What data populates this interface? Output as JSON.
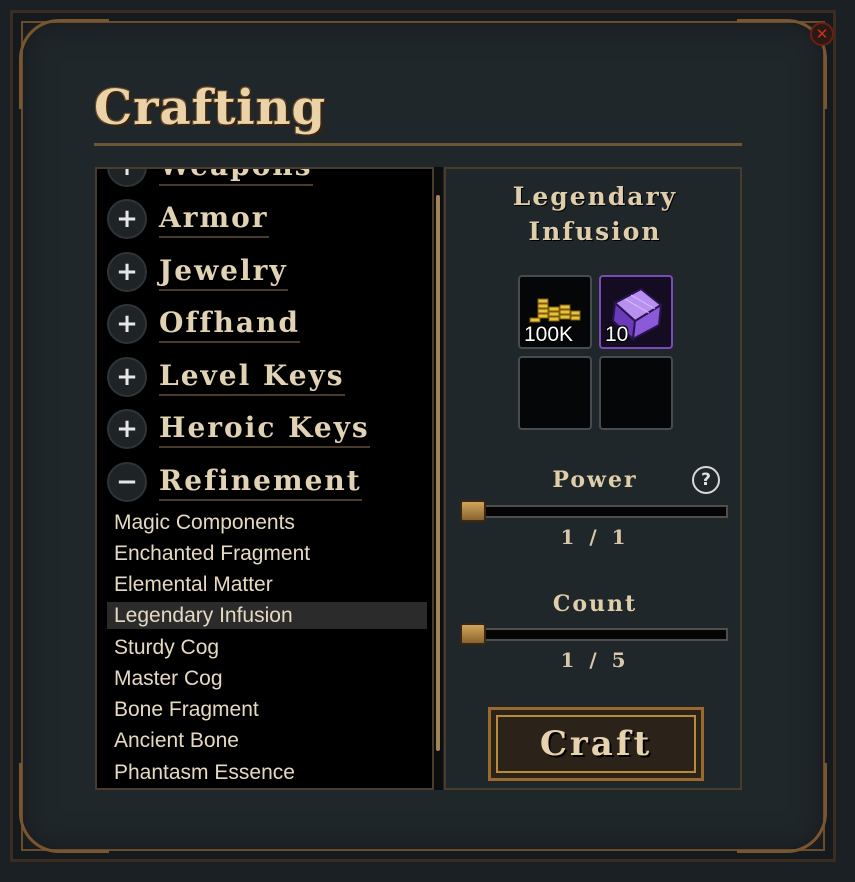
{
  "window": {
    "title": "Crafting",
    "close_symbol": "✕"
  },
  "categories": [
    {
      "label": "Weapons",
      "toggle": "+"
    },
    {
      "label": "Armor",
      "toggle": "+"
    },
    {
      "label": "Jewelry",
      "toggle": "+"
    },
    {
      "label": "Offhand",
      "toggle": "+"
    },
    {
      "label": "Level Keys",
      "toggle": "+"
    },
    {
      "label": "Heroic Keys",
      "toggle": "+"
    },
    {
      "label": "Refinement",
      "toggle": "−"
    }
  ],
  "refinement_items": [
    "Magic Components",
    "Enchanted Fragment",
    "Elemental Matter",
    "Legendary Infusion",
    "Sturdy Cog",
    "Master Cog",
    "Bone Fragment",
    "Ancient Bone",
    "Phantasm Essence"
  ],
  "selected_item": "Legendary Infusion",
  "recipe": {
    "title_line1": "Legendary",
    "title_line2": "Infusion",
    "ingredients": [
      {
        "icon": "gold-coins-icon",
        "quantity": "100K"
      },
      {
        "icon": "purple-crystal-cube-icon",
        "quantity": "10"
      }
    ],
    "empty_slots": 2
  },
  "power": {
    "label": "Power",
    "help_symbol": "?",
    "value_text": "1 / 1",
    "value": 1,
    "max": 1
  },
  "count": {
    "label": "Count",
    "value_text": "1 / 5",
    "value": 1,
    "max": 5
  },
  "craft_button": {
    "label": "Craft"
  },
  "colors": {
    "gold": "#ead3a8",
    "accent_border": "#9a6a2c",
    "selected_row": "#2b2b2b"
  }
}
